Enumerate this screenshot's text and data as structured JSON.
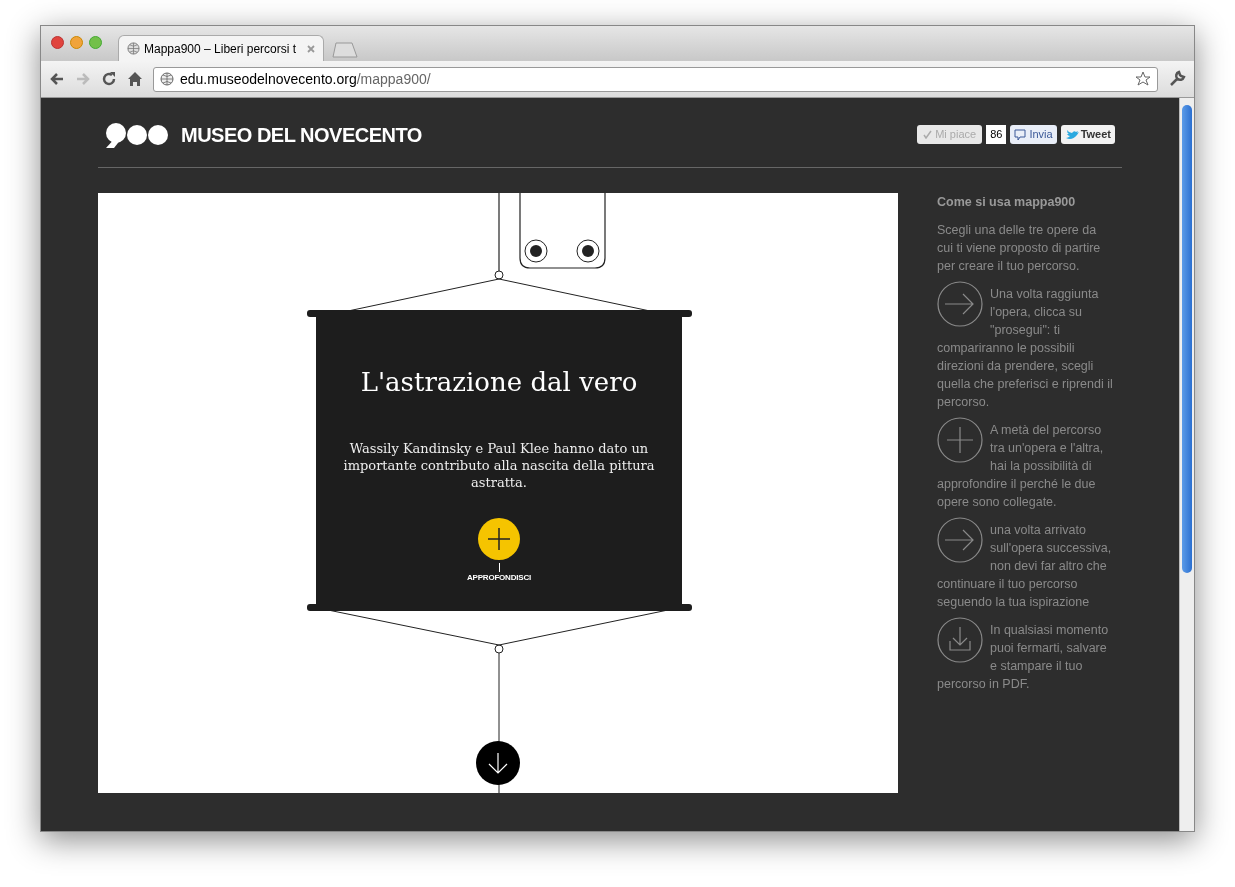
{
  "browser": {
    "tab_title": "Mappa900 – Liberi percorsi t",
    "url_host": "edu.museodelnovecento.org",
    "url_path": "/mappa900/"
  },
  "header": {
    "title": "MUSEO DEL NOVECENTO",
    "social": {
      "like_label": "Mi piace",
      "like_count": "86",
      "share_label": "Invia",
      "tweet_label": "Tweet"
    }
  },
  "panel": {
    "title": "L'astrazione dal vero",
    "body": "Wassily Kandinsky  e Paul Klee hanno dato un importante contributo alla nascita della pittura astratta.",
    "more_label": "APPROFONDISCI"
  },
  "sidebar": {
    "heading": "Come si usa mappa900",
    "items": [
      {
        "kind": "text",
        "text": "Scegli una delle tre opere da cui ti viene proposto di partire per creare il tuo percorso."
      },
      {
        "kind": "arrow",
        "text": "Una volta raggiunta l'opera, clicca su \"prosegui\": ti compariranno le possibili direzioni da prendere, scegli quella che preferisci e riprendi il percorso."
      },
      {
        "kind": "plus",
        "text": "A metà del percorso tra un'opera e l'altra, hai la possibilità di approfondire il perché le due opere sono collegate."
      },
      {
        "kind": "arrow",
        "text": "una volta arrivato sull'opera successiva, non devi far altro che continuare il tuo percorso seguendo la tua ispirazione"
      },
      {
        "kind": "download",
        "text": "In qualsiasi momento puoi fermarti, salvare e stampare il tuo percorso in PDF."
      }
    ]
  }
}
